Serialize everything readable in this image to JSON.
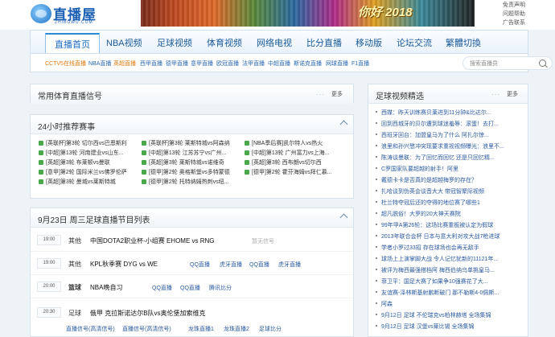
{
  "header": {
    "logo_text": "直播屋",
    "logo_sub": "ZHIBOWU.COM",
    "banner_slogan": "你好 2018",
    "top_links": [
      "免责声明",
      "问题帮助",
      "广告联系"
    ]
  },
  "nav": {
    "items": [
      "直播首页",
      "NBA视频",
      "足球视频",
      "体育视频",
      "网络电视",
      "比分直播",
      "移动版",
      "论坛交流",
      "繁體切換"
    ]
  },
  "subnav": {
    "items": [
      "CCTV5在线直播",
      "NBA直播",
      "英超直播",
      "西甲直播",
      "德甲直播",
      "意甲直播",
      "欧冠直播",
      "法甲直播",
      "中超直播",
      "斯诺克直播",
      "网球直播",
      "F1直播"
    ],
    "search_placeholder": "搜索直播员"
  },
  "panels": {
    "signal": {
      "title": "常用体育直播信号",
      "more": "更多"
    },
    "recommend": {
      "title": "24小时推荐赛事"
    },
    "schedule": {
      "title": "9月23日 周三足球直播节目列表"
    },
    "videos": {
      "title": "足球视频精选",
      "more": "更多"
    }
  },
  "recommend_items": [
    "[英联杯]第3轮 切尔西vs巴恩斯利",
    "[英联杯]第3轮 莱斯特城vs阿森纳",
    "[NBA季后赛]凯尔特人vs热火",
    "[中超]第13轮 河南建业vs山东...",
    "[中超]第13轮 江苏苏宁vs广州...",
    "[中超]第13轮 广州富力vs上海...",
    "[英超]第3轮 布莱顿vs曼联",
    "[英超]第3轮 莱斯特城vs诺维奇",
    "[英超]第3轮 西布朗vs切尔西",
    "[意甲]第2轮 国际米兰vs佛罗伦萨",
    "[德甲]第2轮 奥格斯堡vs多特蒙德",
    "[德甲]第2轮 霍芬海姆vs拜仁慕...",
    "[英超]第3轮 曼城vs莱斯特城",
    "[德甲]第2轮 托特纳姆热刺vs纽...",
    ""
  ],
  "schedule": [
    {
      "time": "19:00",
      "type": "其他",
      "match": "中国DOTA2职业杯-小组赛 EHOME vs RNG",
      "channels": [
        "暂无信号"
      ],
      "gray": true
    },
    {
      "time": "19:00",
      "type": "其他",
      "match": "KPL秋季赛 DYG vs WE",
      "channels": [
        "QQ直播",
        "虎牙直播",
        "QQ直播",
        "虎牙直播"
      ],
      "gray": false
    },
    {
      "time": "20:00",
      "type": "篮球",
      "match": "NBA晚自习",
      "channels": [
        "QQ直播",
        "QQ直播",
        "腾讯比分"
      ],
      "gray": false
    },
    {
      "time": "20:30",
      "type": "足球",
      "match": "俄甲 克拉斯诺达尔B队vs奥伦堡加索维克",
      "channels": [
        "直播信号(高清信号)",
        "直播信号(高清信号)",
        "龙珠直播1",
        "龙珠直播2",
        "足球比分"
      ],
      "gray": false
    }
  ],
  "videos": [
    "西媒：昨天训练赛贝莱进到11分钟&比达尔...",
    "回到西城牙的贝尔遭到球迷羞辱：滚蛋！去打...",
    "西班牙回台：加盟皇马为了什么 阿扎尔惊...",
    "浪里和孙兴慜冲突现要求重视视频曝光：浪里不...",
    "陈涛谈曼联：为了回忆而回忆 还是只回忆精...",
    "C罗国家队要超越的射手！阿里",
    "戴德卡卡是否真的是超越梅罗的存在？",
    "扎哈谈到伪英会谈音大大 带冠智聚际视频",
    "杜兰特夺冠后还的夺得的地位赛了哪些1",
    "超凡脱俗！大罗的20大神天赛院",
    "99年甲A第26轮：这场比赛重板被认定为假球",
    "2013年联合会杯 日本与意大利对攻大战7枪进球",
    "学者小罗过33招 存在球场也会再无敌手",
    "球场上上演掌脚大战 令人记忆犹新的11121年...",
    "被评为梅西最强搭档阿 梅西伯纳乌单挑皇马...",
    "菲卫平：国足大赛了如果争10强赛花了大...",
    "友谊赛-泽林斯基射鹏断破门 那不勒斯4-0佩斯...",
    "阿森",
    "9月12日 足球 不伦瑞克vs柏林赫塔 全场集锦",
    "9月12日 足球 汉堡vs莱比锡 全场集锦"
  ]
}
